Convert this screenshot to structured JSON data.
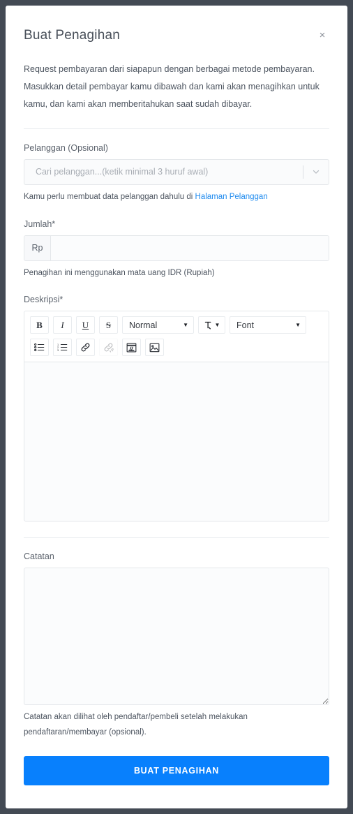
{
  "modal": {
    "title": "Buat Penagihan",
    "close_label": "×",
    "description": "Request pembayaran dari siapapun dengan berbagai metode pembayaran. Masukkan detail pembayar kamu dibawah dan kami akan menagihkan untuk kamu, dan kami akan memberitahukan saat sudah dibayar."
  },
  "customer": {
    "label": "Pelanggan (Opsional)",
    "placeholder": "Cari pelanggan...(ketik minimal 3 huruf awal)",
    "hint_prefix": "Kamu perlu membuat data pelanggan dahulu di ",
    "hint_link": "Halaman Pelanggan"
  },
  "amount": {
    "label": "Jumlah*",
    "prefix": "Rp",
    "value": "",
    "placeholder": "",
    "hint": "Penagihan ini menggunakan mata uang IDR (Rupiah)"
  },
  "description": {
    "label": "Deskripsi*",
    "value": "",
    "toolbar": {
      "bold": "B",
      "italic": "I",
      "underline": "U",
      "strike": "S",
      "block_format": "Normal",
      "font": "Font",
      "caret": "▼",
      "icons": [
        "bullet-list-icon",
        "ordered-list-icon",
        "link-icon",
        "unlink-icon",
        "video-embed-icon",
        "image-icon"
      ]
    }
  },
  "note": {
    "label": "Catatan",
    "value": "",
    "placeholder": "",
    "hint": "Catatan akan dilihat oleh pendaftar/pembeli setelah melakukan pendaftaran/membayar (opsional)."
  },
  "submit": {
    "label": "BUAT PENAGIHAN"
  },
  "colors": {
    "page_background": "#434a54",
    "modal_background": "#ffffff",
    "accent": "#0880fd",
    "link": "#1f8bef",
    "text": "#4d5560",
    "border": "#e4e7ea"
  }
}
